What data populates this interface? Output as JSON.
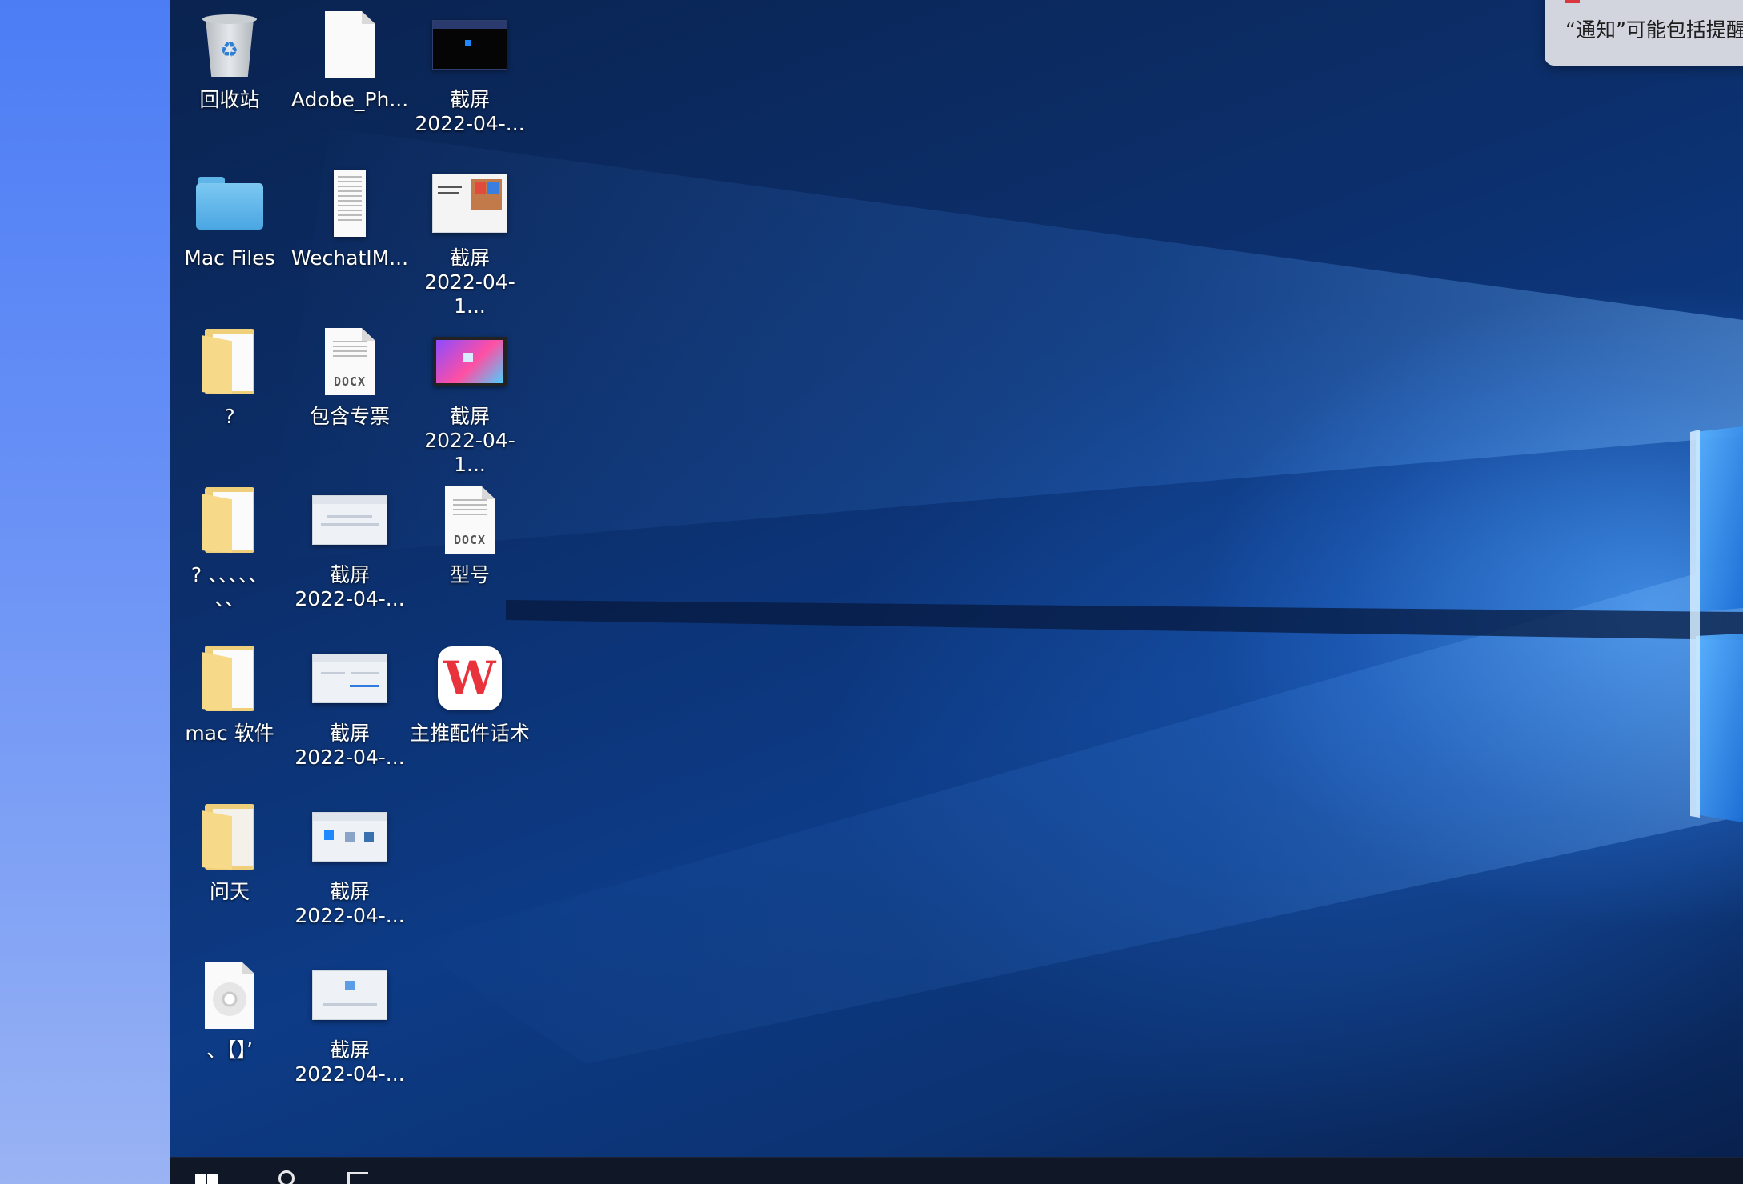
{
  "notification": {
    "text": "“通知”可能包括提醒"
  },
  "desktop_icons": [
    {
      "label": "回收站",
      "type": "recycle-bin"
    },
    {
      "label": "Adobe_Ph...",
      "type": "file"
    },
    {
      "label": "截屏\n2022-04-...",
      "type": "screenshot-dark"
    },
    {
      "label": "Mac Files",
      "type": "mac-folder"
    },
    {
      "label": "WechatIM...",
      "type": "image-file"
    },
    {
      "label": "截屏\n2022-04-1...",
      "type": "screenshot-box"
    },
    {
      "label": "?",
      "type": "folder"
    },
    {
      "label": "包含专票",
      "type": "docx"
    },
    {
      "label": "截屏\n2022-04-1...",
      "type": "screenshot-win11"
    },
    {
      "label": "? 、、、、、\n、、",
      "type": "folder"
    },
    {
      "label": "截屏\n2022-04-...",
      "type": "screenshot"
    },
    {
      "label": "型号",
      "type": "docx"
    },
    {
      "label": "mac 软件",
      "type": "folder"
    },
    {
      "label": "截屏\n2022-04-...",
      "type": "screenshot"
    },
    {
      "label": "主推配件话术",
      "type": "wps"
    },
    {
      "label": "问天",
      "type": "folder"
    },
    {
      "label": "截屏\n2022-04-...",
      "type": "screenshot"
    },
    {
      "label": "、【】’",
      "type": "disc-file"
    },
    {
      "label": "截屏\n2022-04-...",
      "type": "screenshot"
    }
  ],
  "icons": {
    "recycle": "♻",
    "mac": "",
    "wps": "W",
    "docx": "DOCX"
  },
  "colors": {
    "desktop_dark": "#0a2350",
    "desktop_light": "#4696f0",
    "mac_strip": "#4c7df5",
    "taskbar": "#101827"
  }
}
